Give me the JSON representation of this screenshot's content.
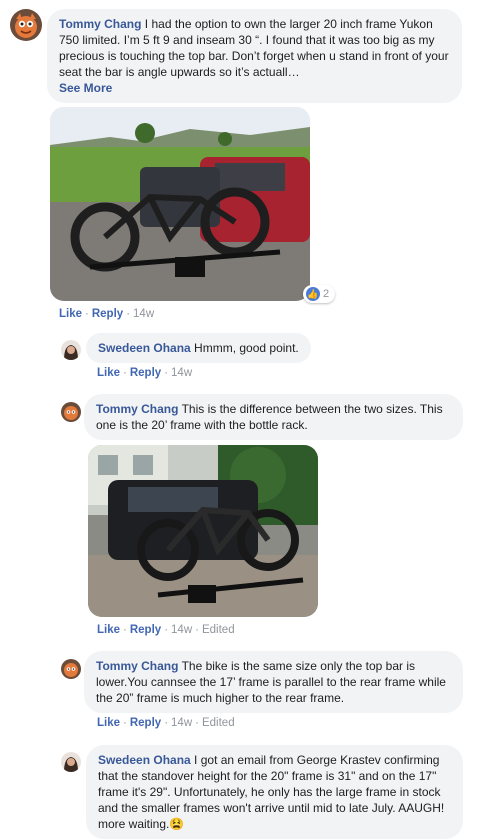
{
  "comments": [
    {
      "author": "Tommy Chang",
      "text": "I had the option to own the larger 20 inch frame Yukon 750 limited. I’m 5 ft 9 and inseam 30 “. I found that it was too big as my precious is touching the top bar. Don’t forget when u stand in front of your seat the bar is angle upwards so it’s actuall…",
      "see_more": "See More",
      "reaction_count": "2",
      "like": "Like",
      "reply": "Reply",
      "time": "14w"
    },
    {
      "author": "Swedeen Ohana",
      "text": "Hmmm, good point.",
      "like": "Like",
      "reply": "Reply",
      "time": "14w"
    },
    {
      "author": "Tommy Chang",
      "text": "This is the difference between the two sizes. This one is the 20’ frame with the bottle rack.",
      "like": "Like",
      "reply": "Reply",
      "time": "14w",
      "edited": "Edited"
    },
    {
      "author": "Tommy Chang",
      "text": "The bike is the same size only the top bar is lower.You cannsee the 17’ frame is parallel to the rear frame while the 20” frame is much higher to the rear frame.",
      "like": "Like",
      "reply": "Reply",
      "time": "14w",
      "edited": "Edited"
    },
    {
      "author": "Swedeen Ohana",
      "text": "I got an email from George Krastev confirming that the standover height for the 20\" frame is 31\" and on the 17\" frame it's 29\". Unfortunately, he only has the large frame in stock and the smaller frames won't arrive until mid to late July. AAUGH! more waiting.",
      "emoji": "😫"
    }
  ],
  "icons": {
    "reaction": "like-icon"
  },
  "colors": {
    "name": "#385898",
    "link": "#4267b2",
    "meta": "#90949c",
    "bubble": "#f2f3f5"
  }
}
